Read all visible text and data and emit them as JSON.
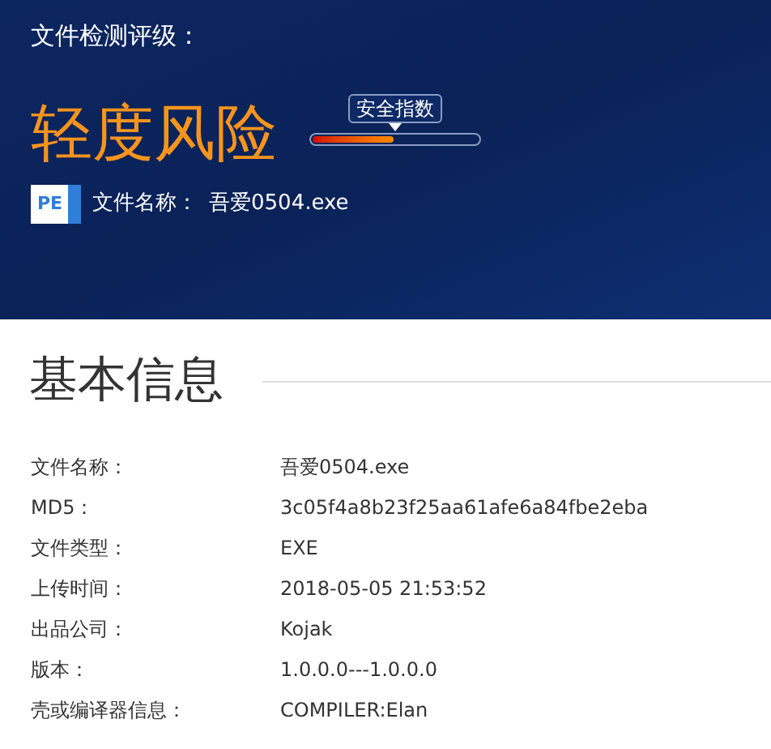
{
  "header": {
    "title": "文件检测评级：",
    "risk_level": "轻度风险",
    "safety_index": {
      "label": "安全指数",
      "level": 0.49
    },
    "file_icon_label": "PE",
    "file_name_label": "文件名称：",
    "file_name": "吾爱0504.exe"
  },
  "basic_info": {
    "heading": "基本信息",
    "rows": [
      {
        "label": "文件名称：",
        "value": "吾爱0504.exe"
      },
      {
        "label": "MD5：",
        "value": "3c05f4a8b23f25aa61afe6a84fbe2eba"
      },
      {
        "label": "文件类型：",
        "value": "EXE"
      },
      {
        "label": "上传时间：",
        "value": "2018-05-05 21:53:52"
      },
      {
        "label": "出品公司：",
        "value": "Kojak"
      },
      {
        "label": "版本：",
        "value": "1.0.0.0---1.0.0.0"
      },
      {
        "label": "壳或编译器信息：",
        "value": "COMPILER:Elan"
      }
    ]
  }
}
